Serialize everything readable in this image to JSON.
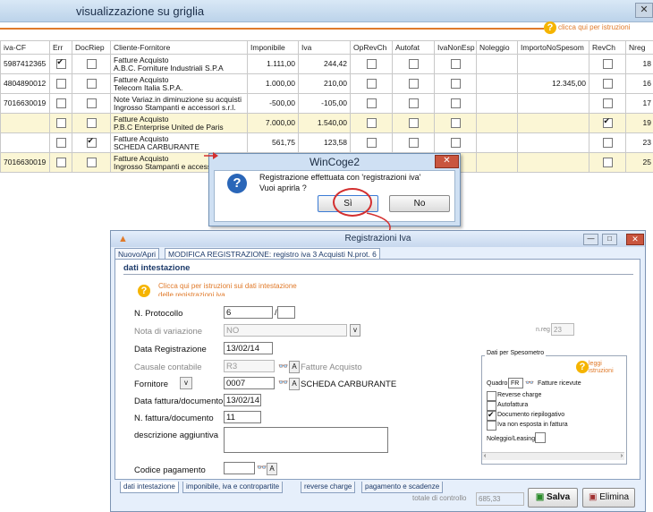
{
  "top": {
    "title": "visualizzazione su griglia",
    "help_label": "clicca qui per istruzioni",
    "close_label": "✕"
  },
  "grid": {
    "headers": [
      "iva-CF",
      "Err",
      "DocRiep",
      "Cliente-Fornitore",
      "Imponibile",
      "Iva",
      "OpRevCh",
      "Autofat",
      "IvaNonEsp",
      "Noleggio",
      "ImportoNoSpesom",
      "RevCh",
      "Nreg"
    ],
    "rows": [
      {
        "cf": "5987412365",
        "err": true,
        "docriep": false,
        "cli1": "Fatture Acquisto",
        "cli2": "A.B.C. Forniture Industriali S.P.A",
        "imp": "1.111,00",
        "iva": "244,42",
        "imp_nospesom": "",
        "revch": false,
        "nreg": "18"
      },
      {
        "cf": "4804890012",
        "err": false,
        "docriep": false,
        "cli1": "Fatture Acquisto",
        "cli2": "Telecom Italia S.P.A.",
        "imp": "1.000,00",
        "iva": "210,00",
        "imp_nospesom": "12.345,00",
        "revch": false,
        "nreg": "16"
      },
      {
        "cf": "7016630019",
        "err": false,
        "docriep": false,
        "cli1": "Note Variaz.in diminuzione su acquisti",
        "cli2": "Ingrosso Stampanti e accessori s.r.l.",
        "imp": "-500,00",
        "iva": "-105,00",
        "imp_nospesom": "",
        "revch": false,
        "nreg": "17"
      },
      {
        "cf": "",
        "err": false,
        "docriep": false,
        "cli1": "Fatture Acquisto",
        "cli2": "P.B.C Enterprise United de Paris",
        "imp": "7.000,00",
        "iva": "1.540,00",
        "imp_nospesom": "",
        "revch": true,
        "nreg": "19"
      },
      {
        "cf": "",
        "err": false,
        "docriep": true,
        "cli1": "Fatture Acquisto",
        "cli2": "SCHEDA CARBURANTE",
        "imp": "561,75",
        "iva": "123,58",
        "imp_nospesom": "",
        "revch": false,
        "nreg": "23"
      },
      {
        "cf": "7016630019",
        "err": false,
        "docriep": false,
        "cli1": "Fatture Acquisto",
        "cli2": "Ingrosso Stampanti e access",
        "imp": "",
        "iva": "",
        "imp_nospesom": "",
        "revch": false,
        "nreg": "25"
      }
    ]
  },
  "dialog": {
    "title": "WinCoge2",
    "line1": "Registrazione effettuata con 'registrazioni iva'",
    "line2": "Vuoi aprirla ?",
    "yes": "Sì",
    "no": "No",
    "close": "✕"
  },
  "form": {
    "title": "Registrazioni Iva",
    "tab1": "Nuovo/Apri",
    "tab2": "MODIFICA REGISTRAZIONE: registro iva 3 Acquisti N.prot. 6",
    "section": "dati intestazione",
    "help": "Clicca qui per istruzioni sui dati intestazione delle registrazioni iva",
    "protocollo_label": "N. Protocollo",
    "protocollo_value": "6",
    "protocollo_sep": "/",
    "nota_label": "Nota di variazione",
    "nota_value": "NO",
    "nreg_label": "n.reg",
    "nreg_value": "23",
    "data_reg_label": "Data Registrazione",
    "data_reg_value": "13/02/14",
    "causale_label": "Causale contabile",
    "causale_value": "R3",
    "causale_desc": "Fatture Acquisto",
    "fornitore_label": "Fornitore",
    "fornitore_value": "0007",
    "fornitore_desc": "SCHEDA CARBURANTE",
    "data_fatt_label": "Data fattura/documento",
    "data_fatt_value": "13/02/14",
    "n_fatt_label": "N. fattura/documento",
    "n_fatt_value": "11",
    "desc_label": "descrizione aggiuntiva",
    "codice_label": "Codice pagamento",
    "spes_title": "Dati per Spesometro",
    "spes_help": "leggi istruzioni",
    "quadro_label": "Quadro",
    "quadro_value": "FR",
    "quadro_desc": "Fatture ricevute",
    "reverse_label": "Reverse charge",
    "autofatt_label": "Autofattura",
    "docriep_label": "Documento riepilogativo",
    "ivanon_label": "Iva non esposta in fattura",
    "noleggio_label": "Noleggio/Leasing",
    "btab1": "dati intestazione",
    "btab2": "imponibile, iva e contropartite",
    "btab3": "reverse charge",
    "btab4": "pagamento e scadenze",
    "tot_label": "totale di controllo",
    "tot_value": "685,33",
    "save": "Salva",
    "delete": "Elimina"
  }
}
